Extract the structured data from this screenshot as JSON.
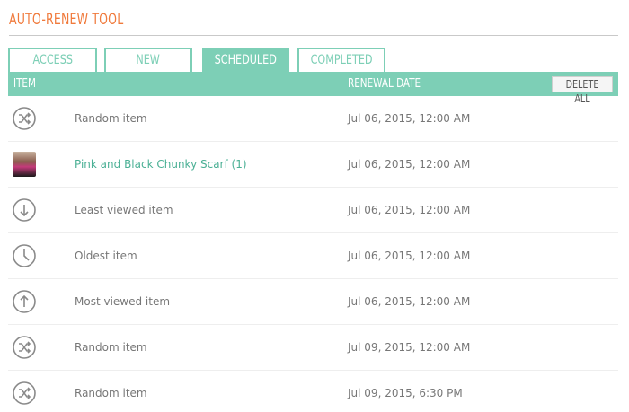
{
  "app": {
    "title": "AUTO-RENEW TOOL"
  },
  "tabs": [
    {
      "label": "ACCESS",
      "active": false
    },
    {
      "label": "NEW",
      "active": false
    },
    {
      "label": "SCHEDULED",
      "active": true
    },
    {
      "label": "COMPLETED",
      "active": false
    }
  ],
  "table": {
    "col_item": "ITEM",
    "col_date": "RENEWAL DATE",
    "delete_all_label": "DELETE ALL",
    "rows": [
      {
        "icon": "shuffle-icon",
        "name": "Random item",
        "date": "Jul 06, 2015, 12:00 AM",
        "is_link": false
      },
      {
        "icon": "scarf-thumbnail",
        "name": "Pink and Black Chunky Scarf (1)",
        "date": "Jul 06, 2015, 12:00 AM",
        "is_link": true
      },
      {
        "icon": "arrow-down-icon",
        "name": "Least viewed item",
        "date": "Jul 06, 2015, 12:00 AM",
        "is_link": false
      },
      {
        "icon": "clock-icon",
        "name": "Oldest item",
        "date": "Jul 06, 2015, 12:00 AM",
        "is_link": false
      },
      {
        "icon": "arrow-up-icon",
        "name": "Most viewed item",
        "date": "Jul 06, 2015, 12:00 AM",
        "is_link": false
      },
      {
        "icon": "shuffle-icon",
        "name": "Random item",
        "date": "Jul 09, 2015, 12:00 AM",
        "is_link": false
      },
      {
        "icon": "shuffle-icon",
        "name": "Random item",
        "date": "Jul 09, 2015, 6:30 PM",
        "is_link": false
      }
    ]
  },
  "colors": {
    "accent": "#7dcfb6",
    "title": "#f07a3c",
    "link": "#4bb095"
  }
}
